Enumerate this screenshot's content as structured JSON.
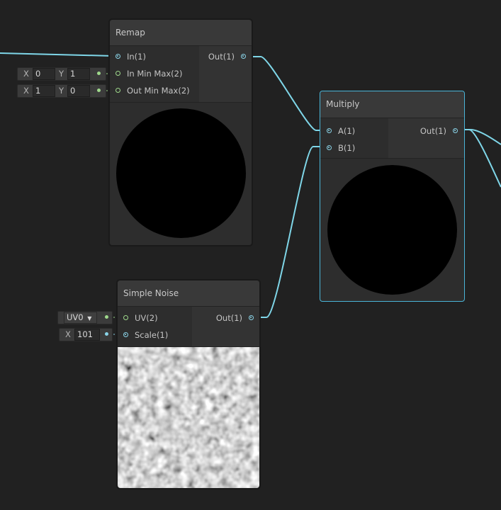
{
  "remap": {
    "title": "Remap",
    "in_label": "In(1)",
    "in_min_max_label": "In Min Max(2)",
    "out_min_max_label": "Out Min Max(2)",
    "out_label": "Out(1)",
    "in_min_max": {
      "x_label": "X",
      "x": "0",
      "y_label": "Y",
      "y": "1"
    },
    "out_min_max": {
      "x_label": "X",
      "x": "1",
      "y_label": "Y",
      "y": "0"
    }
  },
  "multiply": {
    "title": "Multiply",
    "a_label": "A(1)",
    "b_label": "B(1)",
    "out_label": "Out(1)"
  },
  "simple_noise": {
    "title": "Simple Noise",
    "uv_label": "UV(2)",
    "scale_label": "Scale(1)",
    "out_label": "Out(1)",
    "uv_value": "UV0",
    "scale_x_label": "X",
    "scale_value": "101"
  },
  "colors": {
    "background": "#212121",
    "wire": "#7fd6e8",
    "selection": "#4ab5d8",
    "vector2_port": "#9fd98c",
    "float_port": "#8ad4e8"
  }
}
